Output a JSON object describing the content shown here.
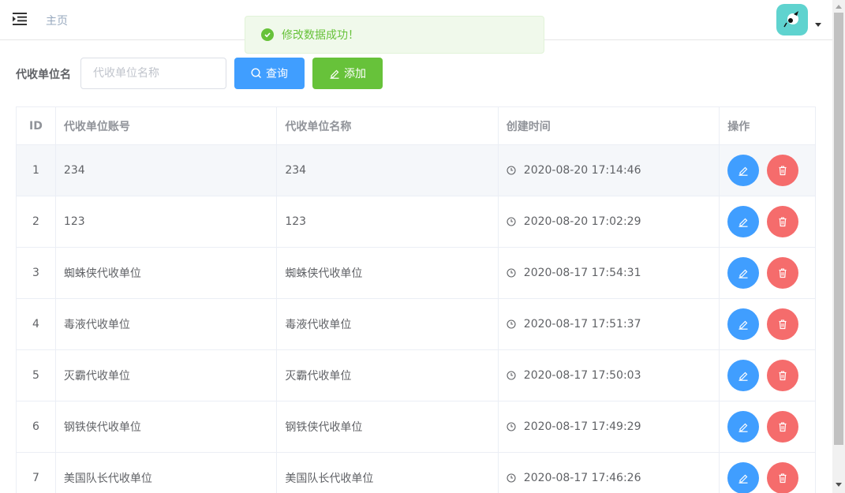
{
  "header": {
    "breadcrumb": "主页"
  },
  "toast": {
    "message": "修改数据成功！",
    "color": "#67c23a"
  },
  "filter": {
    "label": "代收单位名",
    "placeholder": "代收单位名称",
    "search_label": "查询",
    "add_label": "添加"
  },
  "table": {
    "columns": [
      "ID",
      "代收单位账号",
      "代收单位名称",
      "创建时间",
      "操作"
    ],
    "rows": [
      {
        "id": "1",
        "account": "234",
        "name": "234",
        "created": "2020-08-20 17:14:46"
      },
      {
        "id": "2",
        "account": "123",
        "name": "123",
        "created": "2020-08-20 17:02:29"
      },
      {
        "id": "3",
        "account": "蜘蛛侠代收单位",
        "name": "蜘蛛侠代收单位",
        "created": "2020-08-17 17:54:31"
      },
      {
        "id": "4",
        "account": "毒液代收单位",
        "name": "毒液代收单位",
        "created": "2020-08-17 17:51:37"
      },
      {
        "id": "5",
        "account": "灭霸代收单位",
        "name": "灭霸代收单位",
        "created": "2020-08-17 17:50:03"
      },
      {
        "id": "6",
        "account": "钢铁侠代收单位",
        "name": "钢铁侠代收单位",
        "created": "2020-08-17 17:49:29"
      },
      {
        "id": "7",
        "account": "美国队长代收单位",
        "name": "美国队长代收单位",
        "created": "2020-08-17 17:46:26"
      }
    ]
  },
  "colors": {
    "primary": "#409eff",
    "success": "#67c23a",
    "danger": "#f56c6c"
  },
  "icons": {
    "menu": "menu-fold-icon",
    "search": "search-icon",
    "edit": "edit-icon",
    "delete": "delete-icon",
    "clock": "clock-icon",
    "check": "check-icon"
  }
}
